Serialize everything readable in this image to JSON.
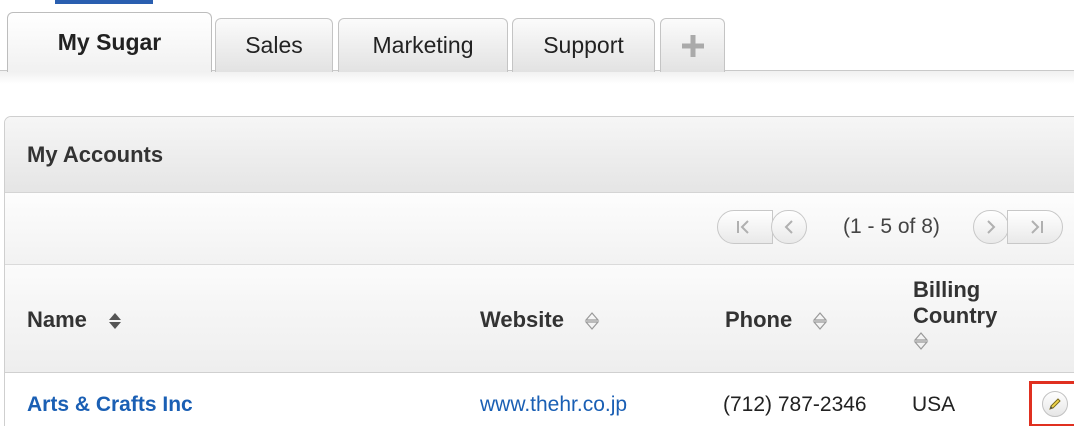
{
  "tabs": [
    {
      "label": "My Sugar",
      "active": true
    },
    {
      "label": "Sales"
    },
    {
      "label": "Marketing"
    },
    {
      "label": "Support"
    }
  ],
  "add_tab_icon": "plus-icon",
  "dashlet": {
    "title": "My Accounts",
    "pagination": {
      "text": "(1 - 5 of 8)"
    },
    "columns": {
      "name": "Name",
      "website": "Website",
      "phone": "Phone",
      "billing_line1": "Billing",
      "billing_line2": "Country"
    },
    "rows": [
      {
        "name": "Arts & Crafts Inc",
        "website": "www.thehr.co.jp",
        "phone": "(712) 787-2346",
        "country": "USA"
      }
    ]
  },
  "colors": {
    "link": "#1a5fb4",
    "highlight": "#e03020"
  }
}
